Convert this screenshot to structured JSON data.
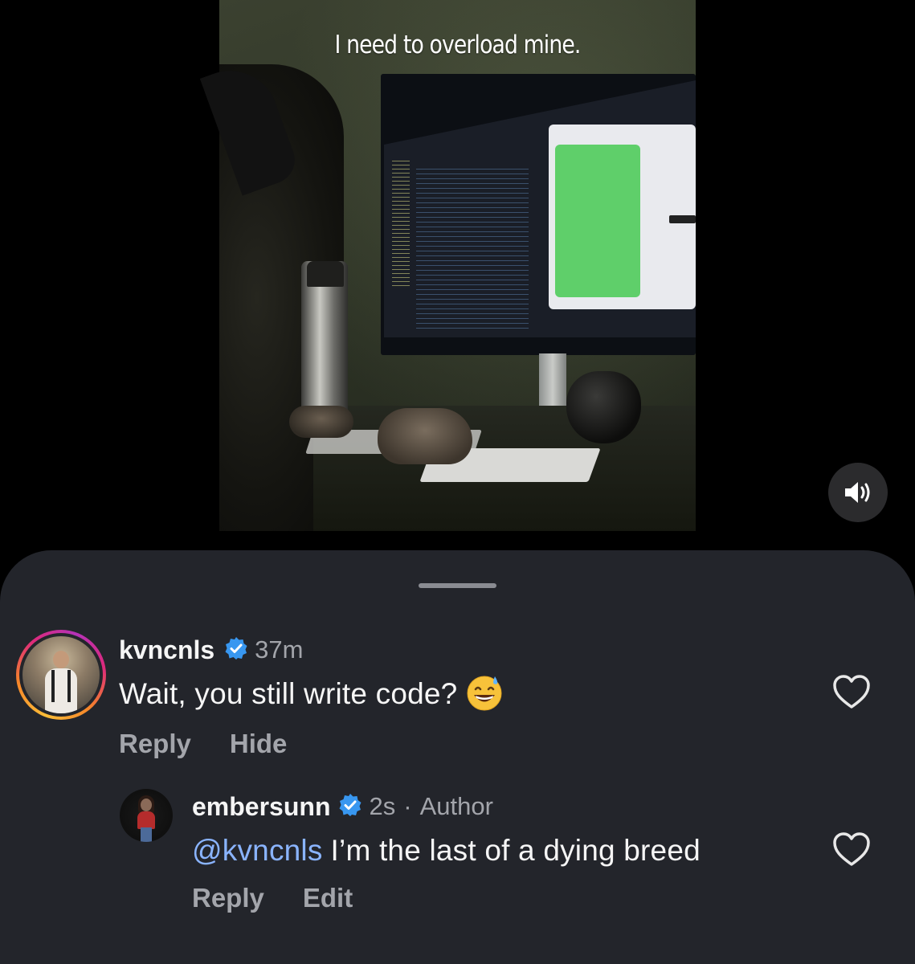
{
  "video": {
    "caption": "I need to overload mine.",
    "sound_icon": "speaker-on-icon"
  },
  "comments": [
    {
      "username": "kvncnls",
      "verified": true,
      "time": "37m",
      "text": "Wait, you still write code?",
      "emoji": "grinning-face-with-sweat-emoji",
      "actions": {
        "reply": "Reply",
        "hide": "Hide"
      }
    },
    {
      "username": "embersunn",
      "verified": true,
      "time": "2s",
      "separator": "·",
      "author_badge": "Author",
      "mention": "@kvncnls",
      "text": "I’m the last of a dying breed",
      "actions": {
        "reply": "Reply",
        "edit": "Edit"
      }
    }
  ],
  "colors": {
    "sheet_bg": "#23252b",
    "verified_blue": "#3897f0",
    "mention_blue": "#8ab4ff",
    "muted_text": "#a3a5ab"
  }
}
